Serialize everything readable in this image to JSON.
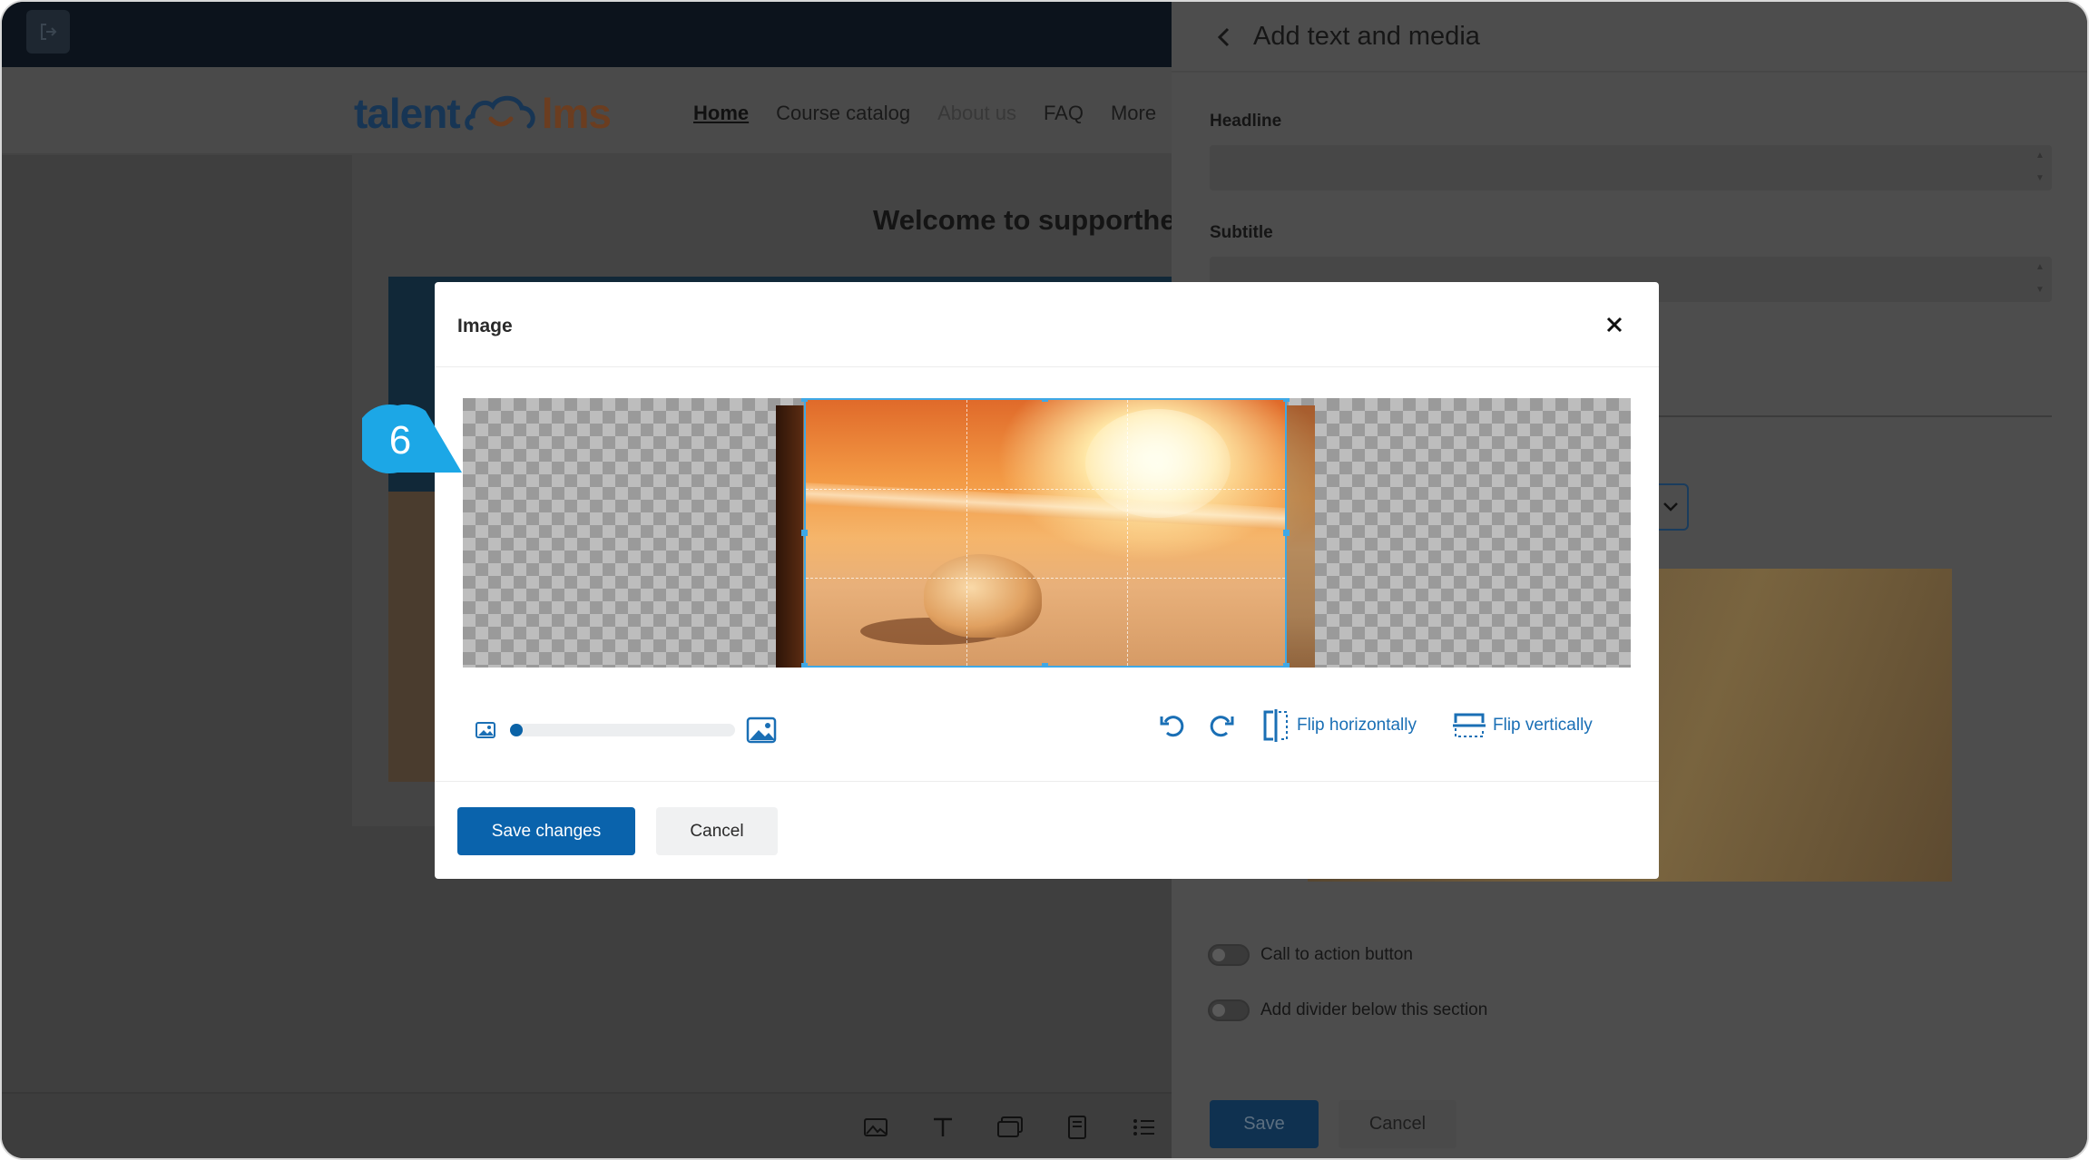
{
  "site": {
    "logo_part1": "talent",
    "logo_part2": "lms",
    "nav": [
      "Home",
      "Course catalog",
      "About us",
      "FAQ",
      "More"
    ],
    "welcome": "Welcome to supporther"
  },
  "panel": {
    "title": "Add text and media",
    "headline_label": "Headline",
    "subtitle_label": "Subtitle",
    "toggle_cta": "Call to action button",
    "toggle_divider": "Add divider below this section",
    "save": "Save",
    "cancel": "Cancel"
  },
  "modal": {
    "title": "Image",
    "zoom_level": 0.0,
    "flip_horizontal": "Flip horizontally",
    "flip_vertical": "Flip vertically",
    "save": "Save changes",
    "cancel": "Cancel"
  },
  "callout": {
    "step": "6"
  },
  "colors": {
    "primary": "#0a63ac",
    "link": "#1a6fb5",
    "crop_border": "#3ea8e6",
    "callout": "#1ca7e6"
  },
  "icons": {
    "exit": "exit-icon",
    "back": "chevron-left-icon",
    "close": "close-icon",
    "zoom_out": "image-small-icon",
    "zoom_in": "image-large-icon",
    "rotate_left": "rotate-left-icon",
    "rotate_right": "rotate-right-icon",
    "flip_h": "flip-horizontal-icon",
    "flip_v": "flip-vertical-icon"
  }
}
